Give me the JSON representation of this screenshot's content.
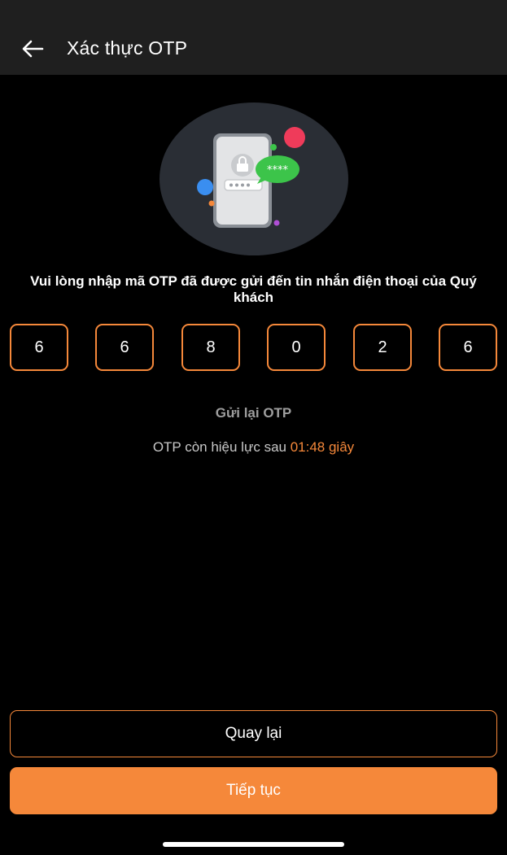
{
  "header": {
    "title": "Xác thực OTP",
    "back_icon": "arrow-left-icon"
  },
  "illustration": {
    "icon": "phone-otp-illustration",
    "bubble_text": "****",
    "colors": {
      "circle": "#2a2e35",
      "phone": "#e0e0e0",
      "bubble": "#3cc44a",
      "red_dot": "#ef3b5a",
      "blue_dot": "#3a8ef0"
    }
  },
  "instruction": "Vui lòng nhập mã OTP đã được gửi đến tin nhắn điện thoại của Quý khách",
  "otp": {
    "digits": [
      "6",
      "6",
      "8",
      "0",
      "2",
      "6"
    ]
  },
  "resend_label": "Gửi lại OTP",
  "validity": {
    "prefix": "OTP còn hiệu lực sau ",
    "countdown": "01:48 giây"
  },
  "buttons": {
    "back_label": "Quay lại",
    "continue_label": "Tiếp tục"
  },
  "colors": {
    "accent": "#f5883a",
    "background": "#000000",
    "app_bar": "#1f1f1f"
  }
}
